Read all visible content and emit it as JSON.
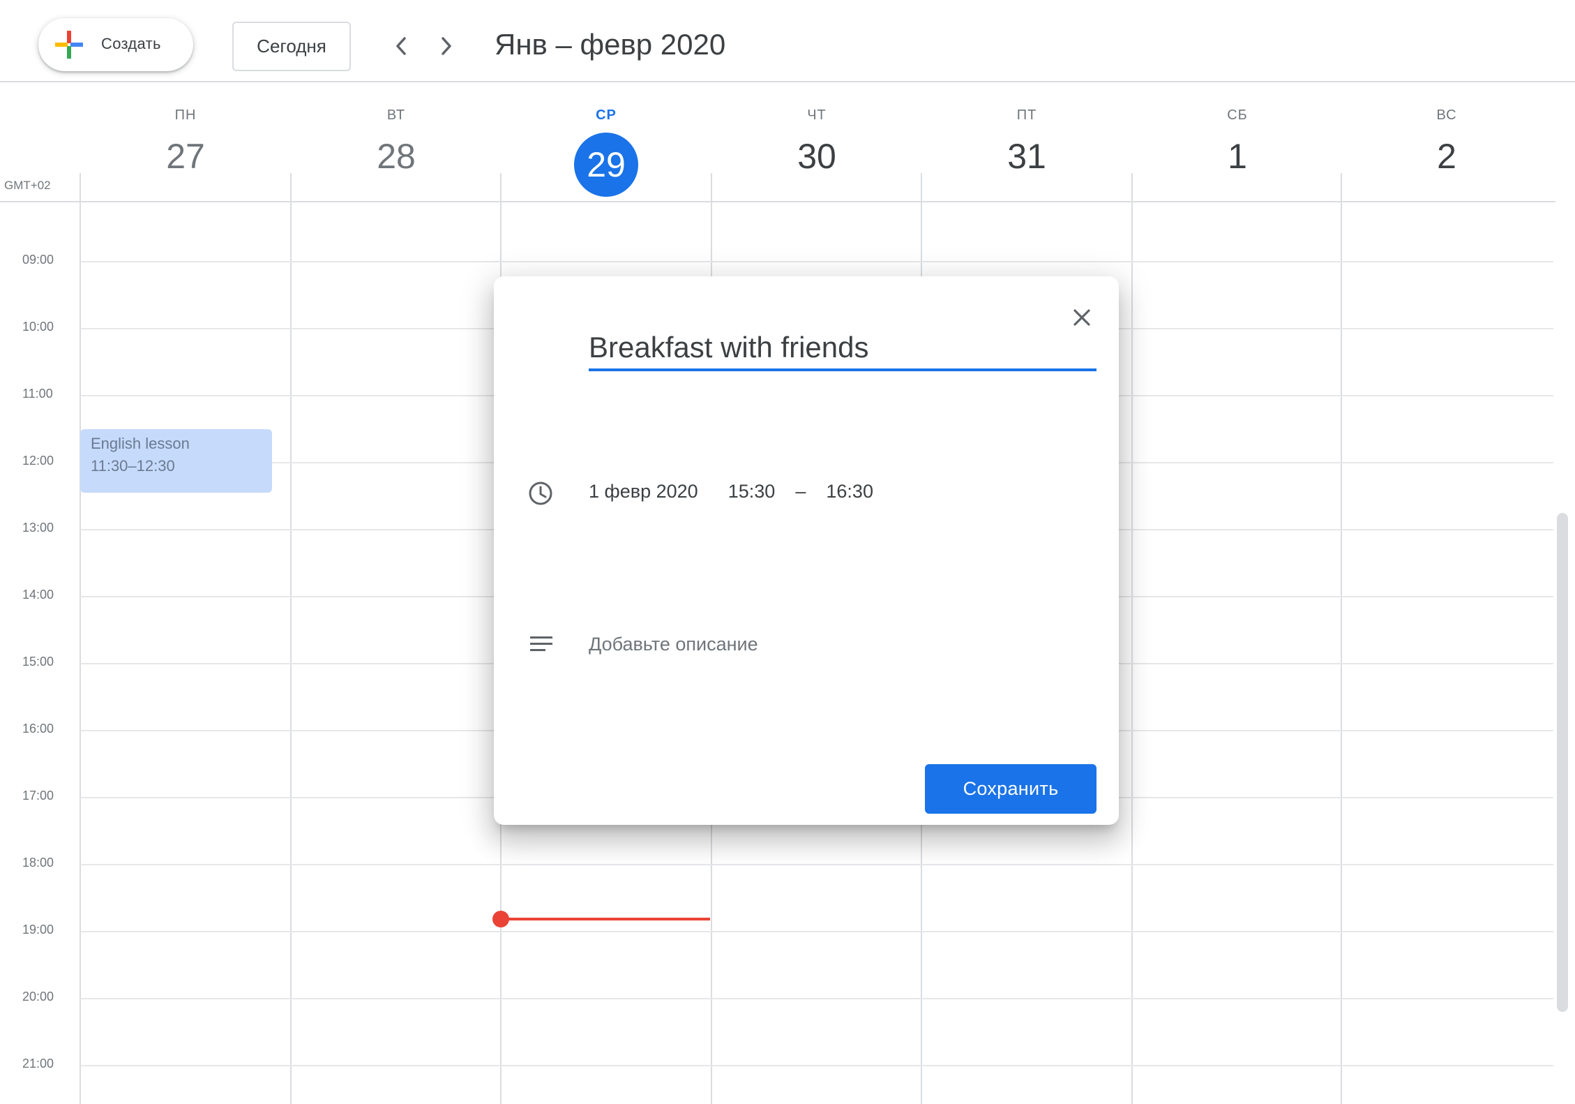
{
  "header": {
    "create_label": "Создать",
    "today_label": "Сегодня",
    "range_title": "Янв – февр 2020"
  },
  "timezone": "GMT+02",
  "days": [
    {
      "name": "ПН",
      "number": "27"
    },
    {
      "name": "ВТ",
      "number": "28"
    },
    {
      "name": "СР",
      "number": "29",
      "today": true
    },
    {
      "name": "ЧТ",
      "number": "30"
    },
    {
      "name": "ПТ",
      "number": "31"
    },
    {
      "name": "СБ",
      "number": "1"
    },
    {
      "name": "ВС",
      "number": "2"
    }
  ],
  "hours": [
    "09:00",
    "10:00",
    "11:00",
    "12:00",
    "13:00",
    "14:00",
    "15:00",
    "16:00",
    "17:00",
    "18:00",
    "19:00",
    "20:00",
    "21:00"
  ],
  "event": {
    "title": "English lesson",
    "time": "11:30–12:30"
  },
  "dialog": {
    "title_value": "Breakfast with friends",
    "date": "1 февр 2020",
    "start_time": "15:30",
    "separator": "–",
    "end_time": "16:30",
    "description_placeholder": "Добавьте описание",
    "save_label": "Сохранить"
  },
  "colors": {
    "accent": "#1a73e8",
    "event_bg": "#c6dafc",
    "now_indicator": "#ea4335"
  },
  "icons": [
    "plus-icon",
    "chevron-left-icon",
    "chevron-right-icon",
    "close-icon",
    "clock-icon",
    "description-icon"
  ]
}
